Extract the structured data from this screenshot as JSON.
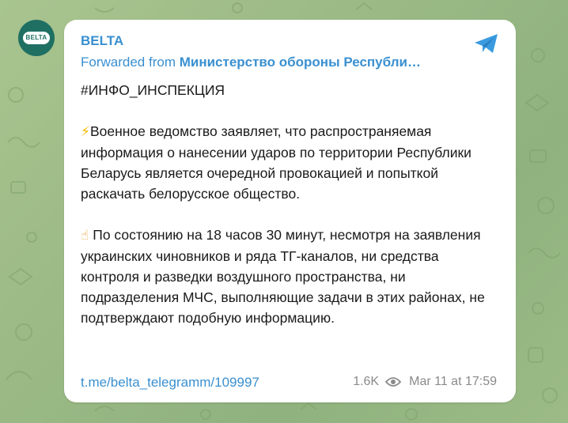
{
  "channel": {
    "name": "BELTA",
    "avatar_text": "BELTA",
    "forwarded_prefix": "Forwarded from ",
    "forwarded_source": "Министерство обороны Республи…"
  },
  "message": {
    "hashtag": "#ИНФО_ИНСПЕКЦИЯ",
    "paragraph1_emoji": "⚡",
    "paragraph1_text": "Военное ведомство заявляет, что распространяемая информация о нанесении ударов по территории Республики Беларусь является очередной провокацией и попыткой раскачать белорусское общество.",
    "paragraph2_emoji": "☝",
    "paragraph2_text": "По состоянию на 18 часов 30 минут, несмотря на заявления украинских чиновников и ряда ТГ-каналов, ни средства контроля и разведки воздушного пространства, ни подразделения МЧС, выполняющие задачи в этих районах, не подтверждают подобную информацию.",
    "link": "t.me/belta_telegramm/109997"
  },
  "meta": {
    "views": "1.6K",
    "timestamp": "Mar 11 at 17:59"
  },
  "icons": {
    "share": "share-icon",
    "views": "eye-icon"
  },
  "colors": {
    "accent": "#3a90d0",
    "avatar_bg": "#1f6f63",
    "background": "#9ab985"
  }
}
